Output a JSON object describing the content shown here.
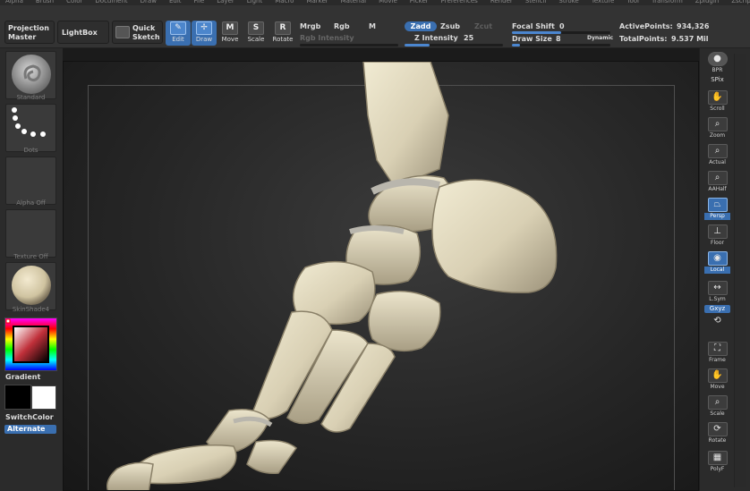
{
  "menu": [
    "Alpha",
    "Brush",
    "Color",
    "Document",
    "Draw",
    "Edit",
    "File",
    "Layer",
    "Light",
    "Macro",
    "Marker",
    "Material",
    "Movie",
    "Picker",
    "Preferences",
    "Render",
    "Stencil",
    "Stroke",
    "Texture",
    "Tool",
    "Transform",
    "Zplugin",
    "Zscript"
  ],
  "toolbar": {
    "projection_master": "Projection Master",
    "lightbox": "LightBox",
    "quick_sketch": "Quick Sketch",
    "edit": "Edit",
    "draw": "Draw",
    "move": "Move",
    "scale": "Scale",
    "rotate": "Rotate",
    "mrgb": "Mrgb",
    "rgb": "Rgb",
    "m": "M",
    "rgb_intensity": "Rgb Intensity",
    "zadd": "Zadd",
    "zsub": "Zsub",
    "zcut": "Zcut",
    "z_intensity_label": "Z Intensity",
    "z_intensity_value": "25",
    "focal_shift_label": "Focal Shift",
    "focal_shift_value": "0",
    "draw_size_label": "Draw Size",
    "draw_size_value": "8",
    "dynamic": "Dynamic",
    "active_points_label": "ActivePoints:",
    "active_points_value": "934,326",
    "total_points_label": "TotalPoints:",
    "total_points_value": "9.537 Mil",
    "z_intensity_level": 0.25,
    "focal_shift_level": 0.5,
    "draw_size_level": 0.08
  },
  "left": {
    "brush": "Standard",
    "stroke": "Dots",
    "alpha": "Alpha Off",
    "texture": "Texture Off",
    "material": "SkinShade4",
    "gradient": "Gradient",
    "switch_color": "SwitchColor",
    "alternate": "Alternate"
  },
  "right": {
    "bpr": "BPR",
    "spix": "SPix",
    "scroll": "Scroll",
    "zoom": "Zoom",
    "actual": "Actual",
    "aahalf": "AAHalf",
    "persp": "Persp",
    "floor": "Floor",
    "local": "Local",
    "lsym": "L.Sym",
    "gxyz": "Gxyz",
    "frame": "Frame",
    "move": "Move",
    "scale": "Scale",
    "rotate": "Rotate",
    "polyf": "PolyF"
  },
  "colors": {
    "accent": "#3a6fb0",
    "bone": "#e3dcc3",
    "bone_shadow": "#8f8670"
  },
  "icons": [
    "scroll-hand-icon",
    "zoom-magnifier-icon",
    "frame-icon",
    "rotate-icon",
    "polyframe-grid-icon"
  ]
}
